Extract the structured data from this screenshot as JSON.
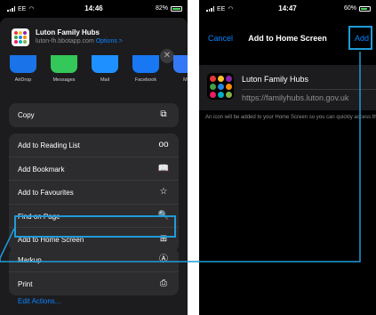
{
  "left": {
    "status": {
      "carrier": "EE",
      "time": "14:46",
      "battery": "82%",
      "battery_level": 0.82
    },
    "share": {
      "title": "Luton Family Hubs",
      "domain": "luton-fh.bbotapp.com",
      "options_label": "Options >",
      "close_glyph": "✕"
    },
    "apps": [
      {
        "label": "AirDrop",
        "color": "#1a73e8"
      },
      {
        "label": "Messages",
        "color": "#34c759"
      },
      {
        "label": "Mail",
        "color": "#1e90ff"
      },
      {
        "label": "Facebook",
        "color": "#1877f2"
      },
      {
        "label": "Me",
        "color": "#3478f6"
      }
    ],
    "groups": [
      {
        "rows": [
          {
            "label": "Copy",
            "icon": "copy-icon",
            "glyph": "⧉"
          }
        ]
      },
      {
        "rows": [
          {
            "label": "Add to Reading List",
            "icon": "glasses-icon",
            "glyph": "oo"
          },
          {
            "label": "Add Bookmark",
            "icon": "book-icon",
            "glyph": "📖"
          },
          {
            "label": "Add to Favourites",
            "icon": "star-icon",
            "glyph": "☆"
          },
          {
            "label": "Find on Page",
            "icon": "find-icon",
            "glyph": "🔍"
          },
          {
            "label": "Add to Home Screen",
            "icon": "plus-square-icon",
            "glyph": "⊞"
          }
        ]
      },
      {
        "rows": [
          {
            "label": "Markup",
            "icon": "markup-icon",
            "glyph": "Ⓐ"
          },
          {
            "label": "Print",
            "icon": "printer-icon",
            "glyph": "⎙"
          }
        ]
      }
    ],
    "edit_actions": "Edit Actions..."
  },
  "right": {
    "status": {
      "carrier": "EE",
      "time": "14:47",
      "battery": "60%",
      "battery_level": 0.6
    },
    "nav": {
      "cancel": "Cancel",
      "title": "Add to Home Screen",
      "add": "Add"
    },
    "card": {
      "name": "Luton Family Hubs",
      "url": "https://familyhubs.luton.gov.uk"
    },
    "note": "An icon will be added to your Home Screen so you can quickly access this website."
  },
  "colors": {
    "accent": "#0a84ff",
    "highlight": "#1e9bd8",
    "logo_dots": [
      "#e53935",
      "#fbc02d",
      "#8e24aa",
      "#43a047",
      "#1e88e5",
      "#fb8c00",
      "#e91e63",
      "#00acc1",
      "#7cb342"
    ]
  }
}
